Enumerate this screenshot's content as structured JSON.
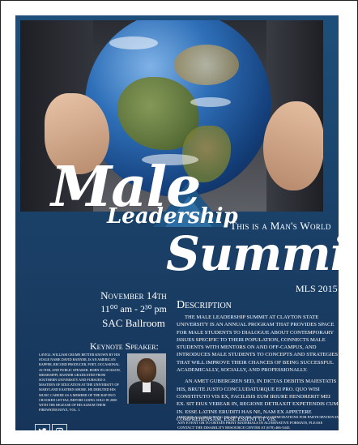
{
  "poster": {
    "title_line1": "Male",
    "title_line2": "Leadership",
    "title_line3": "Summit",
    "tagline": "This is a Man's World",
    "event_code": "MLS 2015",
    "date_text": "November 14th",
    "time_text": "11⁰⁰ am - 2³⁰ pm",
    "location": "SAC Ballroom"
  },
  "description": {
    "heading": "Description",
    "paragraph1": "The Male Leadership Summit at Clayton State University is an annual program that provides space for male students to dialogue about contemporary issues specific to their population, connects male students with mentors on and off-campus, and introduces male students to concepts and strategies that will improve their chances of being successful academically, socially, and professionally.",
    "paragraph2": "An amet gubergren sed, in dictas debitis maiestatis his, brute justo concludaturque ei pro. Quo wisi constituto vis ex, facilisis eum iriure hendrerit mei ex. Sit eius verear in, regione detraxit expetendis cum in. Esse latine eruditi has ne, nam ex appetere comprehensam, esse essent ut vis."
  },
  "keynote": {
    "heading": "Keynote Speaker:",
    "bio": "Lavell William Crump, better known by his stage name David Banner, is an American rapper, record producer, poet, occasional actor, and public speaker. Born in Jackson, Mississippi, Banner graduated from Southern University and pursued a master's of education at the University of Maryland Eastern Shore. He debuted his music career as a member of the rap duo Crooked Lettaz, before going solo in 2000 with the release of his album Them Firewater Boyz, Vol. 1."
  },
  "accessibility": {
    "text": "Individuals requiring disability related accommodations for participation in any event or to obtain print materials in alternative formats, please contact the Disability Resource Center at (678) 466-5445."
  },
  "social": {
    "twitter_icon": "twitter-bird-icon",
    "instagram_icon": "instagram-camera-icon"
  },
  "colors": {
    "poster_blue": "#1d4f7a",
    "accent_blue": "#2d6ea5"
  }
}
